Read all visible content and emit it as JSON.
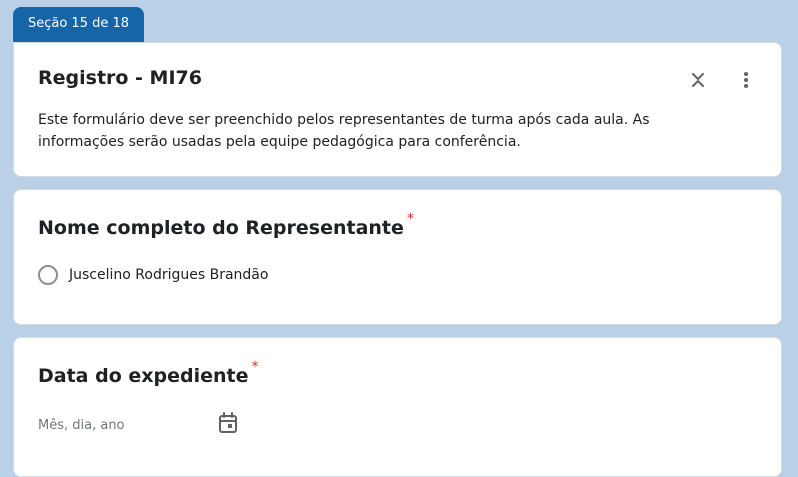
{
  "section_tab": {
    "label": "Seção 15 de 18"
  },
  "header": {
    "title": "Registro - MI76",
    "description": "Este formulário deve ser preenchido pelos representantes de turma após cada aula. As informações serão usadas pela equipe pedagógica para conferência."
  },
  "questions": [
    {
      "title": "Nome completo do Representante",
      "required_mark": "*",
      "options": [
        "Juscelino Rodrigues Brandão"
      ]
    },
    {
      "title": "Data do expediente",
      "required_mark": "*",
      "placeholder": "Mês, dia, ano"
    }
  ],
  "icons": {
    "collapse": "collapse-icon",
    "more": "more-vert-icon",
    "calendar": "calendar-icon"
  },
  "colors": {
    "background": "#b9d0e6",
    "section_tab": "#1565a8",
    "required": "#d93025"
  }
}
